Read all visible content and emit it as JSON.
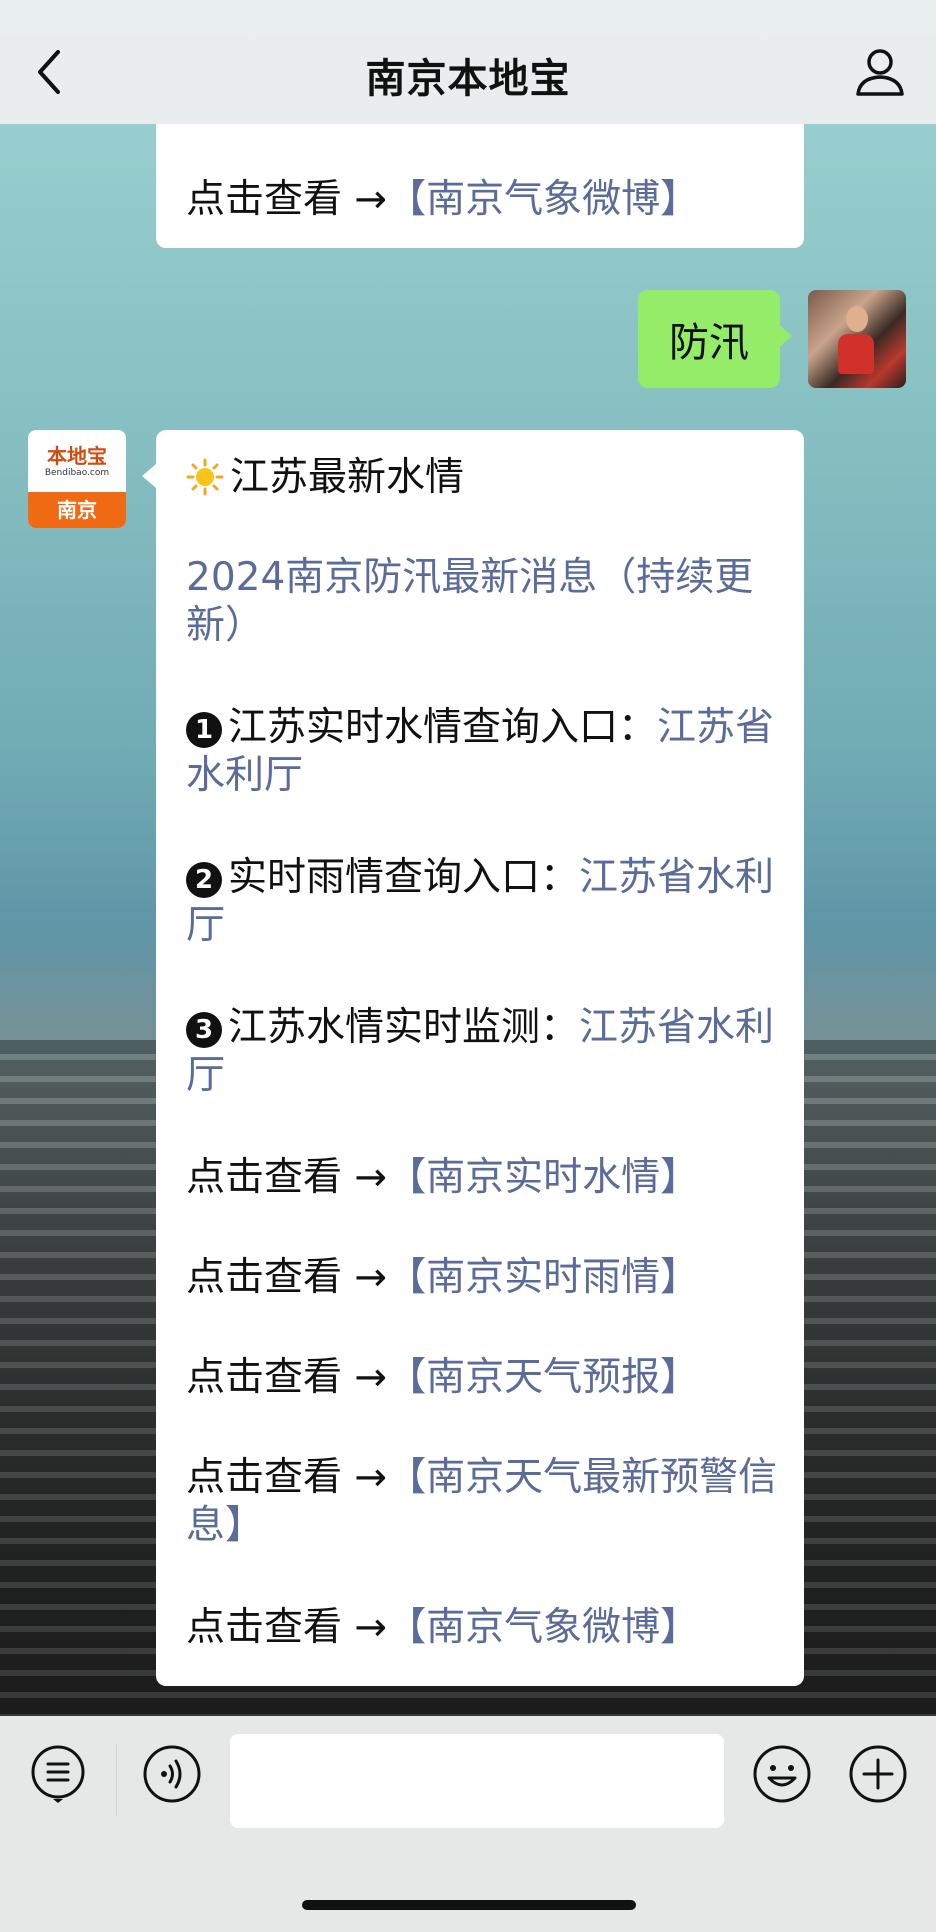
{
  "header": {
    "title": "南京本地宝"
  },
  "top_message": {
    "prefix": "点击查看 →",
    "link": "【南京气象微博】"
  },
  "sent_message": {
    "text": "防汛"
  },
  "bot_avatar": {
    "brand": "本地宝",
    "domain": "Bendibao.com",
    "city": "南京"
  },
  "main_message": {
    "heading": "江苏最新水情",
    "news_link": "2024南京防汛最新消息（持续更新）",
    "items": [
      {
        "num": "1",
        "text": "江苏实时水情查询入口：",
        "link": "江苏省水利厅"
      },
      {
        "num": "2",
        "text": "实时雨情查询入口：",
        "link": "江苏省水利厅"
      },
      {
        "num": "3",
        "text": "江苏水情实时监测：",
        "link": "江苏省水利厅"
      }
    ],
    "view_prefix": "点击查看 →",
    "links": [
      "【南京实时水情】",
      "【南京实时雨情】",
      "【南京天气预报】",
      "【南京天气最新预警信息】",
      "【南京气象微博】"
    ]
  },
  "icons": {
    "back": "chevron-left-icon",
    "user": "person-icon",
    "menu": "list-icon",
    "voice": "voice-icon",
    "emoji": "smile-icon",
    "plus": "plus-icon"
  },
  "colors": {
    "link": "#5b6b9a",
    "sent_bubble": "#95ec69",
    "brand_orange": "#f06a14"
  }
}
